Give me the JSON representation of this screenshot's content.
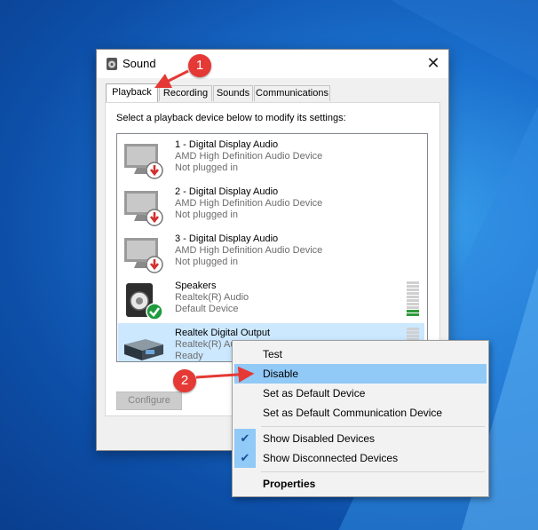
{
  "window": {
    "title": "Sound",
    "close_glyph": "✕"
  },
  "tabs": [
    {
      "label": "Playback",
      "active": true
    },
    {
      "label": "Recording",
      "active": false
    },
    {
      "label": "Sounds",
      "active": false
    },
    {
      "label": "Communications",
      "active": false
    }
  ],
  "instruction": "Select a playback device below to modify its settings:",
  "devices": [
    {
      "name": "1 - Digital Display Audio",
      "driver": "AMD High Definition Audio Device",
      "status": "Not plugged in",
      "icon": "monitor-icon",
      "badge": "unplugged-icon"
    },
    {
      "name": "2 - Digital Display Audio",
      "driver": "AMD High Definition Audio Device",
      "status": "Not plugged in",
      "icon": "monitor-icon",
      "badge": "unplugged-icon"
    },
    {
      "name": "3 - Digital Display Audio",
      "driver": "AMD High Definition Audio Device",
      "status": "Not plugged in",
      "icon": "monitor-icon",
      "badge": "unplugged-icon"
    },
    {
      "name": "Speakers",
      "driver": "Realtek(R) Audio",
      "status": "Default Device",
      "icon": "speaker-icon",
      "badge": "default-check-icon"
    },
    {
      "name": "Realtek Digital Output",
      "driver": "Realtek(R) Au",
      "status": "Ready",
      "icon": "digital-output-icon",
      "selected": true
    }
  ],
  "buttons": {
    "configure": "Configure"
  },
  "context_menu": {
    "items": [
      {
        "label": "Test"
      },
      {
        "label": "Disable",
        "highlighted": true
      },
      {
        "label": "Set as Default Device"
      },
      {
        "label": "Set as Default Communication Device"
      },
      {
        "label": "Show Disabled Devices",
        "checked": true
      },
      {
        "label": "Show Disconnected Devices",
        "checked": true
      },
      {
        "label": "Properties",
        "bold": true
      }
    ],
    "check_glyph": "✔"
  },
  "annotations": {
    "step1": "1",
    "step2": "2"
  },
  "colors": {
    "callout": "#e53935",
    "selection": "#cce8ff",
    "menu_highlight": "#91c9f7",
    "meter_green": "#2e9a3a"
  }
}
